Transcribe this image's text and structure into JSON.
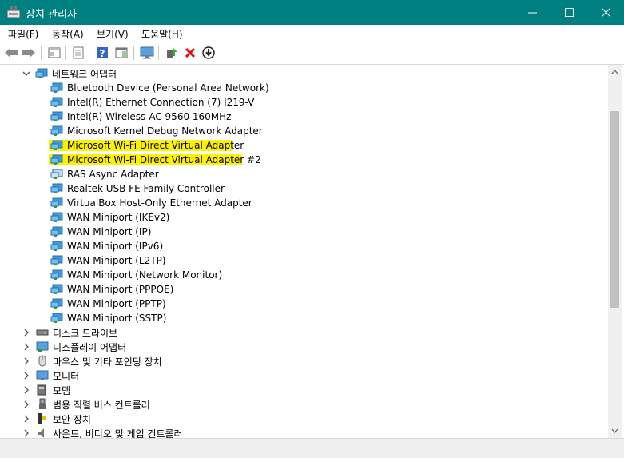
{
  "window": {
    "title": "장치 관리자",
    "accent": "#008080"
  },
  "menu": [
    "파일(F)",
    "동작(A)",
    "보기(V)",
    "도움말(H)"
  ],
  "toolbar": [
    "back-icon",
    "forward-icon",
    "properties-icon",
    "update-icon",
    "help-icon",
    "scan-icon",
    "monitor-icon",
    "enable-driver-icon",
    "uninstall-icon",
    "download-icon"
  ],
  "tree": {
    "network_group": "네트워크 어댑터",
    "network_items": [
      "Bluetooth Device (Personal Area Network)",
      "Intel(R) Ethernet Connection (7) I219-V",
      "Intel(R) Wireless-AC 9560 160MHz",
      "Microsoft Kernel Debug Network Adapter",
      "Microsoft Wi-Fi Direct Virtual Adapter",
      "Microsoft Wi-Fi Direct Virtual Adapter #2",
      "RAS Async Adapter",
      "Realtek USB FE Family Controller",
      "VirtualBox Host-Only Ethernet Adapter",
      "WAN Miniport (IKEv2)",
      "WAN Miniport (IP)",
      "WAN Miniport (IPv6)",
      "WAN Miniport (L2TP)",
      "WAN Miniport (Network Monitor)",
      "WAN Miniport (PPPOE)",
      "WAN Miniport (PPTP)",
      "WAN Miniport (SSTP)"
    ],
    "categories": [
      "디스크 드라이브",
      "디스플레이 어댑터",
      "마우스 및 기타 포인팅 장치",
      "모니터",
      "모뎀",
      "범용 직렬 버스 컨트롤러",
      "보안 장치",
      "사운드, 비디오 및 게임 컨트롤러"
    ]
  }
}
